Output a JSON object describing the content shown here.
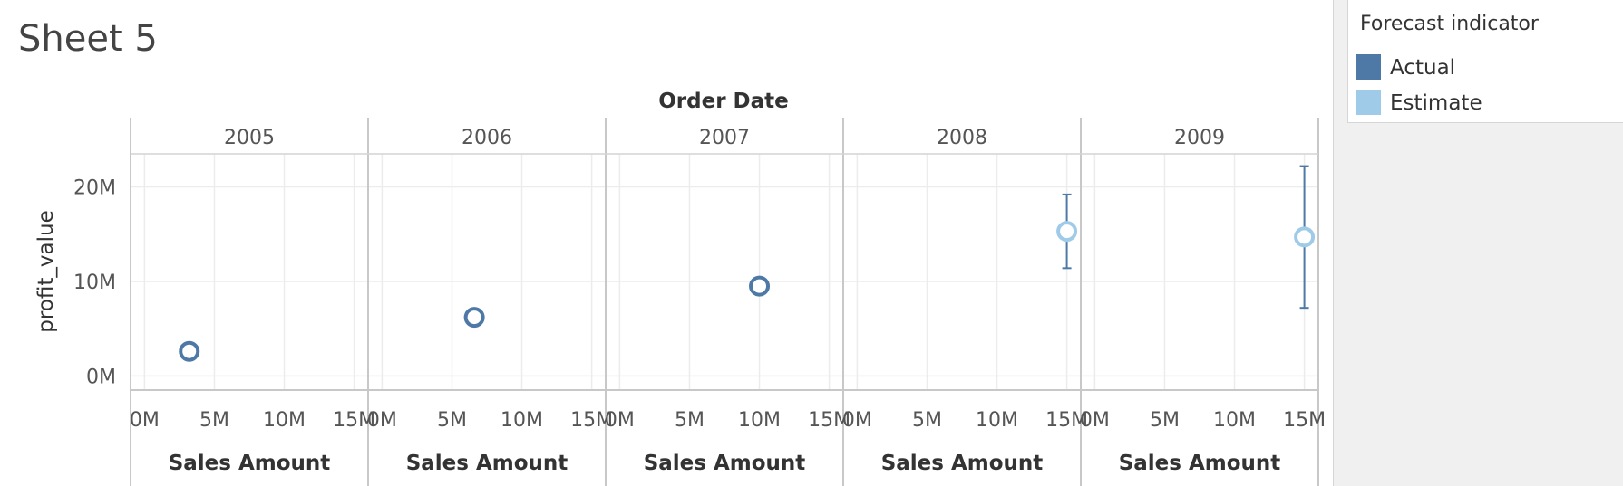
{
  "sheet": {
    "title": "Sheet 5"
  },
  "legend": {
    "title": "Forecast indicator",
    "items": [
      {
        "label": "Actual",
        "color": "#4e79a7"
      },
      {
        "label": "Estimate",
        "color": "#a0cbe8"
      }
    ]
  },
  "chart_data": {
    "type": "scatter",
    "title": "",
    "column_header": "Order Date",
    "columns": [
      "2005",
      "2006",
      "2007",
      "2008",
      "2009"
    ],
    "xlabel": "Sales Amount",
    "ylabel": "profit_value",
    "x_tick_labels": [
      "0M",
      "5M",
      "10M",
      "15M"
    ],
    "x_ticks": [
      0,
      5,
      10,
      15
    ],
    "y_tick_labels": [
      "0M",
      "10M",
      "20M"
    ],
    "y_ticks": [
      0,
      10,
      20
    ],
    "xlim": [
      -1,
      16
    ],
    "ylim": [
      -1.5,
      23.5
    ],
    "units": "millions",
    "grid": true,
    "legend_position": "top-right",
    "points": [
      {
        "column": "2005",
        "x": 3.2,
        "y": 2.6,
        "indicator": "Actual"
      },
      {
        "column": "2006",
        "x": 6.6,
        "y": 6.2,
        "indicator": "Actual"
      },
      {
        "column": "2007",
        "x": 10.0,
        "y": 9.5,
        "indicator": "Actual"
      },
      {
        "column": "2008",
        "x": 15.0,
        "y": 15.3,
        "indicator": "Estimate",
        "error_low": 11.4,
        "error_high": 19.2
      },
      {
        "column": "2009",
        "x": 15.0,
        "y": 14.7,
        "indicator": "Estimate",
        "error_low": 7.2,
        "error_high": 22.2
      }
    ]
  }
}
